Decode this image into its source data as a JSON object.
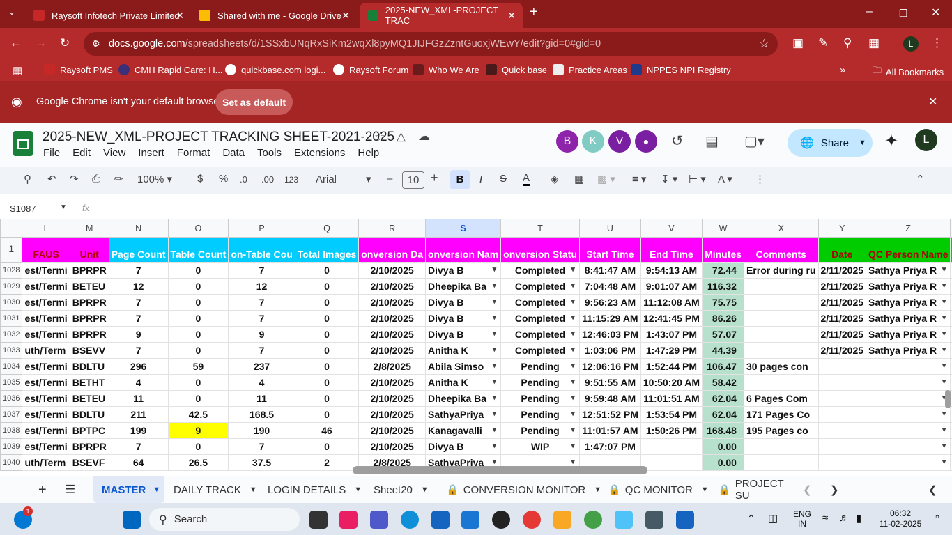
{
  "browser": {
    "tabs": [
      {
        "title": "Raysoft Infotech Private Limited",
        "color": "#c62828"
      },
      {
        "title": "Shared with me - Google Drive",
        "color": "#fbbc04"
      },
      {
        "title": "2025-NEW_XML-PROJECT TRAC",
        "color": "#188038"
      }
    ],
    "url_host": "docs.google.com",
    "url_path": "/spreadsheets/d/1SSxbUNqRxSiKm2wqXl8pyMQ1JIJFGzZzntGuoxjWEwY/edit?gid=0#gid=0",
    "profile_letter": "L",
    "bookmarks": [
      "Raysoft PMS",
      "CMH Rapid Care: H...",
      "quickbase.com logi...",
      "Raysoft Forum",
      "Who We Are",
      "Quick base",
      "Practice Areas",
      "NPPES NPI Registry"
    ],
    "all_bookmarks": "All Bookmarks",
    "infobar_text": "Google Chrome isn't your default browser",
    "set_default_label": "Set as default"
  },
  "doc": {
    "title": "2025-NEW_XML-PROJECT TRACKING SHEET-2021-2025",
    "menus": [
      "File",
      "Edit",
      "View",
      "Insert",
      "Format",
      "Data",
      "Tools",
      "Extensions",
      "Help"
    ],
    "avatars": [
      {
        "letter": "B",
        "color": "#8e24aa"
      },
      {
        "letter": "K",
        "color": "#80cbc4"
      },
      {
        "letter": "V",
        "color": "#7b1fa2"
      }
    ],
    "share_label": "Share",
    "user_letter": "L"
  },
  "format_toolbar": {
    "zoom": "100%",
    "currency": "$",
    "percent": "%",
    "dec_minus": ".0",
    "dec_plus": ".00",
    "num_format": "123",
    "font": "Arial",
    "font_size": "10"
  },
  "formula_bar": {
    "cell_ref": "S1087",
    "fx": "fx"
  },
  "grid": {
    "columns": [
      "L",
      "M",
      "N",
      "O",
      "P",
      "Q",
      "R",
      "S",
      "T",
      "U",
      "V",
      "W",
      "X",
      "Y",
      "Z"
    ],
    "header_row_num": "1",
    "headers": [
      "FAUS",
      "Unit",
      "Page Count",
      "Table Count",
      "on-Table Cou",
      "Total Images",
      "onversion Da",
      "onversion Nam",
      "onversion Statu",
      "Start Time",
      "End Time",
      "Minutes",
      "Comments",
      "Date",
      "QC Person Name"
    ],
    "rows": [
      {
        "num": "1028",
        "cells": [
          "est/Termi",
          "BPRPR",
          "7",
          "0",
          "7",
          "0",
          "2/10/2025",
          "Divya B",
          "Completed",
          "8:41:47 AM",
          "9:54:13 AM",
          "72.44",
          "Error during ru",
          "2/11/2025",
          "Sathya Priya R"
        ]
      },
      {
        "num": "1029",
        "cells": [
          "est/Termi",
          "BETEU",
          "12",
          "0",
          "12",
          "0",
          "2/10/2025",
          "Dheepika Ba",
          "Completed",
          "7:04:48 AM",
          "9:01:07 AM",
          "116.32",
          "",
          "2/11/2025",
          "Sathya Priya R"
        ]
      },
      {
        "num": "1030",
        "cells": [
          "est/Termi",
          "BPRPR",
          "7",
          "0",
          "7",
          "0",
          "2/10/2025",
          "Divya B",
          "Completed",
          "9:56:23 AM",
          "11:12:08 AM",
          "75.75",
          "",
          "2/11/2025",
          "Sathya Priya R"
        ]
      },
      {
        "num": "1031",
        "cells": [
          "est/Termi",
          "BPRPR",
          "7",
          "0",
          "7",
          "0",
          "2/10/2025",
          "Divya B",
          "Completed",
          "11:15:29 AM",
          "12:41:45 PM",
          "86.26",
          "",
          "2/11/2025",
          "Sathya Priya R"
        ]
      },
      {
        "num": "1032",
        "cells": [
          "est/Termi",
          "BPRPR",
          "9",
          "0",
          "9",
          "0",
          "2/10/2025",
          "Divya B",
          "Completed",
          "12:46:03 PM",
          "1:43:07 PM",
          "57.07",
          "",
          "2/11/2025",
          "Sathya Priya R"
        ]
      },
      {
        "num": "1033",
        "cells": [
          "uth/Term",
          "BSEVV",
          "7",
          "0",
          "7",
          "0",
          "2/10/2025",
          "Anitha K",
          "Completed",
          "1:03:06 PM",
          "1:47:29 PM",
          "44.39",
          "",
          "2/11/2025",
          "Sathya Priya R"
        ]
      },
      {
        "num": "1034",
        "cells": [
          "est/Termi",
          "BDLTU",
          "296",
          "59",
          "237",
          "0",
          "2/8/2025",
          "Abila Simso",
          "Pending",
          "12:06:16 PM",
          "1:52:44 PM",
          "106.47",
          "30 pages con",
          "",
          ""
        ]
      },
      {
        "num": "1035",
        "cells": [
          "est/Termi",
          "BETHT",
          "4",
          "0",
          "4",
          "0",
          "2/10/2025",
          "Anitha K",
          "Pending",
          "9:51:55 AM",
          "10:50:20 AM",
          "58.42",
          "",
          "",
          ""
        ]
      },
      {
        "num": "1036",
        "cells": [
          "est/Termi",
          "BETEU",
          "11",
          "0",
          "11",
          "0",
          "2/10/2025",
          "Dheepika Ba",
          "Pending",
          "9:59:48 AM",
          "11:01:51 AM",
          "62.04",
          "6 Pages Com",
          "",
          ""
        ]
      },
      {
        "num": "1037",
        "cells": [
          "est/Termi",
          "BDLTU",
          "211",
          "42.5",
          "168.5",
          "0",
          "2/10/2025",
          "SathyaPriya",
          "Pending",
          "12:51:52 PM",
          "1:53:54 PM",
          "62.04",
          "171 Pages Co",
          "",
          ""
        ]
      },
      {
        "num": "1038",
        "cells": [
          "est/Termi",
          "BPTPC",
          "199",
          "9",
          "190",
          "46",
          "2/10/2025",
          "Kanagavalli",
          "Pending",
          "11:01:57 AM",
          "1:50:26 PM",
          "168.48",
          "195 Pages co",
          "",
          ""
        ]
      },
      {
        "num": "1039",
        "cells": [
          "est/Termi",
          "BPRPR",
          "7",
          "0",
          "7",
          "0",
          "2/10/2025",
          "Divya B",
          "WIP",
          "1:47:07 PM",
          "",
          "0.00",
          "",
          "",
          ""
        ]
      },
      {
        "num": "1040",
        "cells": [
          "uth/Term",
          "BSEVF",
          "64",
          "26.5",
          "37.5",
          "2",
          "2/8/2025",
          "SathyaPriya",
          "",
          "",
          "",
          "0.00",
          "",
          "",
          ""
        ]
      }
    ]
  },
  "sheet_tabs": [
    "MASTER",
    "DAILY TRACK",
    "LOGIN DETAILS",
    "Sheet20",
    "CONVERSION MONITOR",
    "QC MONITOR",
    "PROJECT SU"
  ],
  "taskbar": {
    "search_label": "Search",
    "lang_line1": "ENG",
    "lang_line2": "IN",
    "time": "06:32",
    "date": "11-02-2025",
    "notification_count": "1"
  }
}
